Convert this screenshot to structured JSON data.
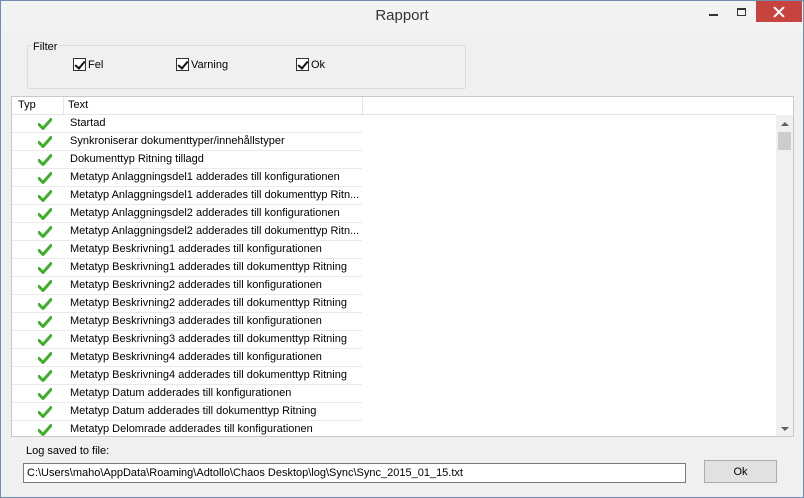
{
  "window": {
    "title": "Rapport",
    "controls": {
      "minimize_icon": "minimize-icon",
      "maximize_icon": "maximize-icon",
      "close_icon": "close-icon",
      "close_color": "#c7433d"
    }
  },
  "filter": {
    "legend": "Filter",
    "options": [
      {
        "label": "Fel",
        "checked": true
      },
      {
        "label": "Varning",
        "checked": true
      },
      {
        "label": "Ok",
        "checked": true
      }
    ]
  },
  "list": {
    "columns": [
      "Typ",
      "Text"
    ],
    "row_icon": "check-ok-icon",
    "row_icon_color": "#3fae2a",
    "rows": [
      "Startad",
      "Synkroniserar dokumenttyper/innehållstyper",
      "Dokumenttyp Ritning tillagd",
      "Metatyp Anlaggningsdel1 adderades till konfigurationen",
      "Metatyp Anlaggningsdel1 adderades till dokumenttyp Ritn...",
      "Metatyp Anlaggningsdel2 adderades till konfigurationen",
      "Metatyp Anlaggningsdel2 adderades till dokumenttyp Ritn...",
      "Metatyp Beskrivning1 adderades till konfigurationen",
      "Metatyp Beskrivning1 adderades till dokumenttyp Ritning",
      "Metatyp Beskrivning2 adderades till konfigurationen",
      "Metatyp Beskrivning2 adderades till dokumenttyp Ritning",
      "Metatyp Beskrivning3 adderades till konfigurationen",
      "Metatyp Beskrivning3 adderades till dokumenttyp Ritning",
      "Metatyp Beskrivning4 adderades till konfigurationen",
      "Metatyp Beskrivning4 adderades till dokumenttyp Ritning",
      "Metatyp Datum adderades till konfigurationen",
      "Metatyp Datum adderades till dokumenttyp Ritning",
      "Metatyp Delomrade adderades till konfigurationen"
    ]
  },
  "log": {
    "label": "Log saved to file:",
    "path": "C:\\Users\\maho\\AppData\\Roaming\\Adtollo\\Chaos Desktop\\log\\Sync\\Sync_2015_01_15.txt"
  },
  "ok_button": {
    "label": "Ok"
  }
}
